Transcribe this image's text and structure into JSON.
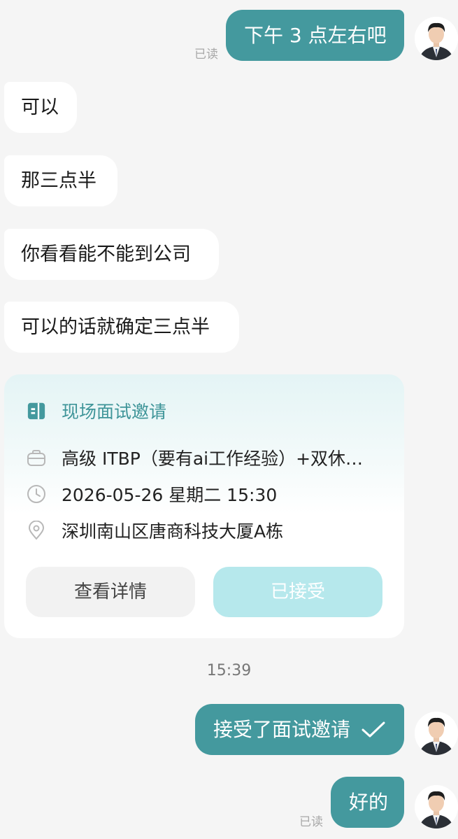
{
  "read_label": "已读",
  "messages": {
    "m1": "下午 3 点左右吧",
    "m2": "可以",
    "m3": "那三点半",
    "m4": "你看看能不能到公司",
    "m5": "可以的话就确定三点半",
    "m6": "接受了面试邀请",
    "m7": "好的"
  },
  "card": {
    "title": "现场面试邀请",
    "job": "高级 ITBP（要有ai工作经验）+双休…",
    "datetime": "2026-05-26 星期二 15:30",
    "address": "深圳南山区唐商科技大厦A栋",
    "detail_button": "查看详情",
    "accepted_button": "已接受"
  },
  "timestamp": "15:39",
  "colors": {
    "accent": "#44999e",
    "accepted_bg": "#b6e8ec",
    "background": "#f5f5f5"
  },
  "icons": [
    "building-icon",
    "briefcase-icon",
    "clock-icon",
    "location-pin-icon",
    "checkmark-icon"
  ]
}
